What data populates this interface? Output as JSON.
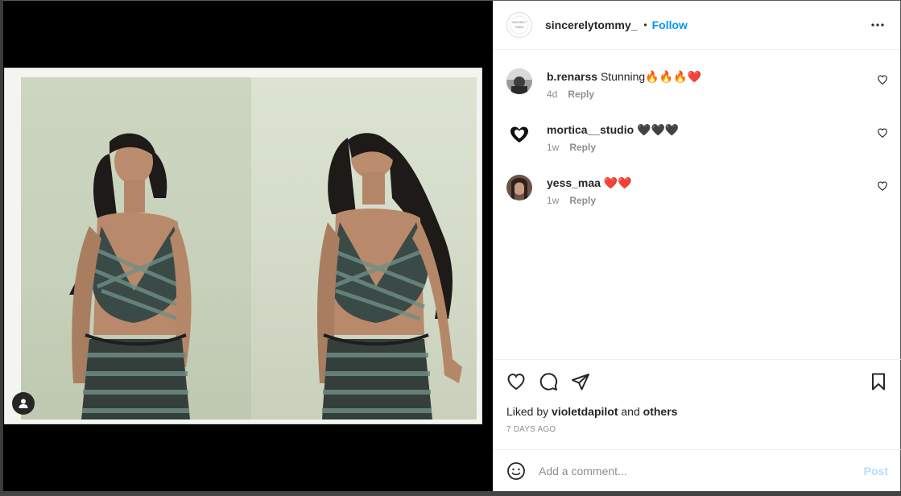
{
  "post": {
    "owner": "sincerelytommy_",
    "follow_label": "Follow",
    "dot": "•",
    "more_icon": "more-horizontal-icon"
  },
  "comments": [
    {
      "user": "b.renarss",
      "text": "Stunning🔥🔥🔥❤️",
      "age": "4d",
      "reply_label": "Reply",
      "avatar_icon": "avatar"
    },
    {
      "user": "mortica__studio",
      "text": "🖤🖤🖤",
      "age": "1w",
      "reply_label": "Reply",
      "avatar_icon": "heart-logo-avatar"
    },
    {
      "user": "yess_maa",
      "text": "❤️❤️",
      "age": "1w",
      "reply_label": "Reply",
      "avatar_icon": "avatar"
    }
  ],
  "actions": {
    "like_icon": "heart-icon",
    "comment_icon": "comment-bubble-icon",
    "share_icon": "paper-plane-icon",
    "save_icon": "bookmark-icon"
  },
  "likes": {
    "prefix": "Liked by",
    "user": "violetdapilot",
    "joiner": "and",
    "others": "others"
  },
  "date_label": "7 DAYS AGO",
  "composer": {
    "placeholder": "Add a comment...",
    "post_label": "Post",
    "emoji_icon": "emoji-smile-icon"
  },
  "colors": {
    "accent": "#0095f6",
    "post_disabled": "#b2dffc",
    "muted": "#8e8e8e"
  }
}
